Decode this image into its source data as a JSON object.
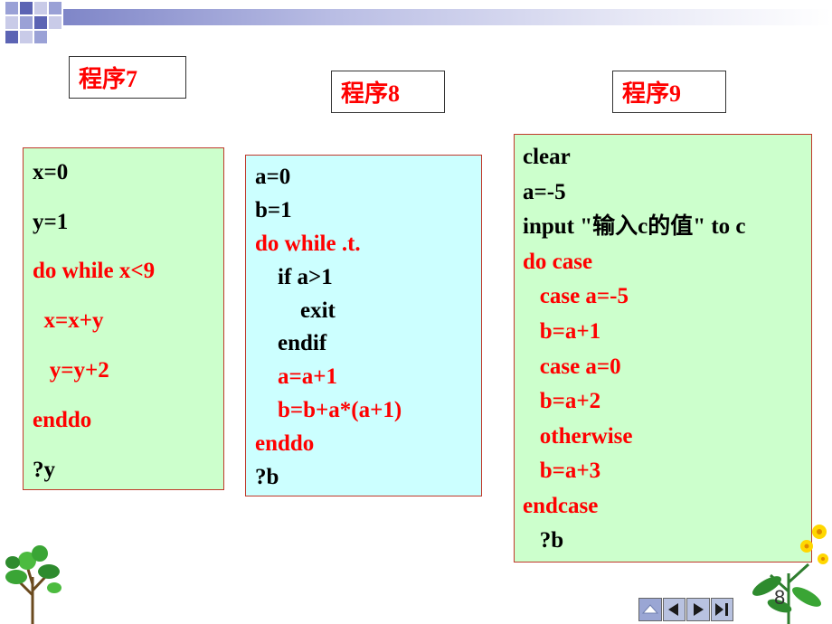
{
  "titles": {
    "prog7": "程序7",
    "prog8": "程序8",
    "prog9": "程序9"
  },
  "panel7": {
    "lines": [
      {
        "text": "x=0",
        "color": "#000000"
      },
      {
        "text": "y=1",
        "color": "#000000"
      },
      {
        "text": "do while x<9",
        "color": "#ff0000"
      },
      {
        "text": "  x=x+y",
        "color": "#ff0000"
      },
      {
        "text": "   y=y+2",
        "color": "#ff0000"
      },
      {
        "text": "enddo",
        "color": "#ff0000"
      },
      {
        "text": "?y",
        "color": "#000000"
      }
    ]
  },
  "panel8": {
    "lines": [
      {
        "text": "a=0",
        "color": "#000000"
      },
      {
        "text": "b=1",
        "color": "#000000"
      },
      {
        "text": "do while .t.",
        "color": "#ff0000"
      },
      {
        "text": "    if a>1",
        "color": "#000000"
      },
      {
        "text": "        exit",
        "color": "#000000"
      },
      {
        "text": "    endif",
        "color": "#000000"
      },
      {
        "text": "    a=a+1",
        "color": "#ff0000"
      },
      {
        "text": "    b=b+a*(a+1)",
        "color": "#ff0000"
      },
      {
        "text": "enddo",
        "color": "#ff0000"
      },
      {
        "text": "?b",
        "color": "#000000"
      }
    ]
  },
  "panel9": {
    "lines": [
      {
        "text": "clear",
        "color": "#000000"
      },
      {
        "text": "a=-5",
        "color": "#000000"
      },
      {
        "text": "input \"输入c的值\" to c",
        "color": "#000000"
      },
      {
        "text": "do case",
        "color": "#ff0000"
      },
      {
        "text": "   case a=-5",
        "color": "#ff0000"
      },
      {
        "text": "   b=a+1",
        "color": "#ff0000"
      },
      {
        "text": "   case a=0",
        "color": "#ff0000"
      },
      {
        "text": "   b=a+2",
        "color": "#ff0000"
      },
      {
        "text": "   otherwise",
        "color": "#ff0000"
      },
      {
        "text": "   b=a+3",
        "color": "#ff0000"
      },
      {
        "text": "endcase",
        "color": "#ff0000"
      },
      {
        "text": "   ?b",
        "color": "#000000"
      }
    ]
  },
  "slide_number": "8",
  "icons": {
    "tree": "tree-icon",
    "flower": "flower-icon",
    "nav": [
      "home-icon",
      "prev-icon",
      "next-icon",
      "last-icon"
    ]
  },
  "colors": {
    "panel_green": "#ccffcc",
    "panel_cyan": "#ccffff",
    "keyword_red": "#ff0000"
  }
}
